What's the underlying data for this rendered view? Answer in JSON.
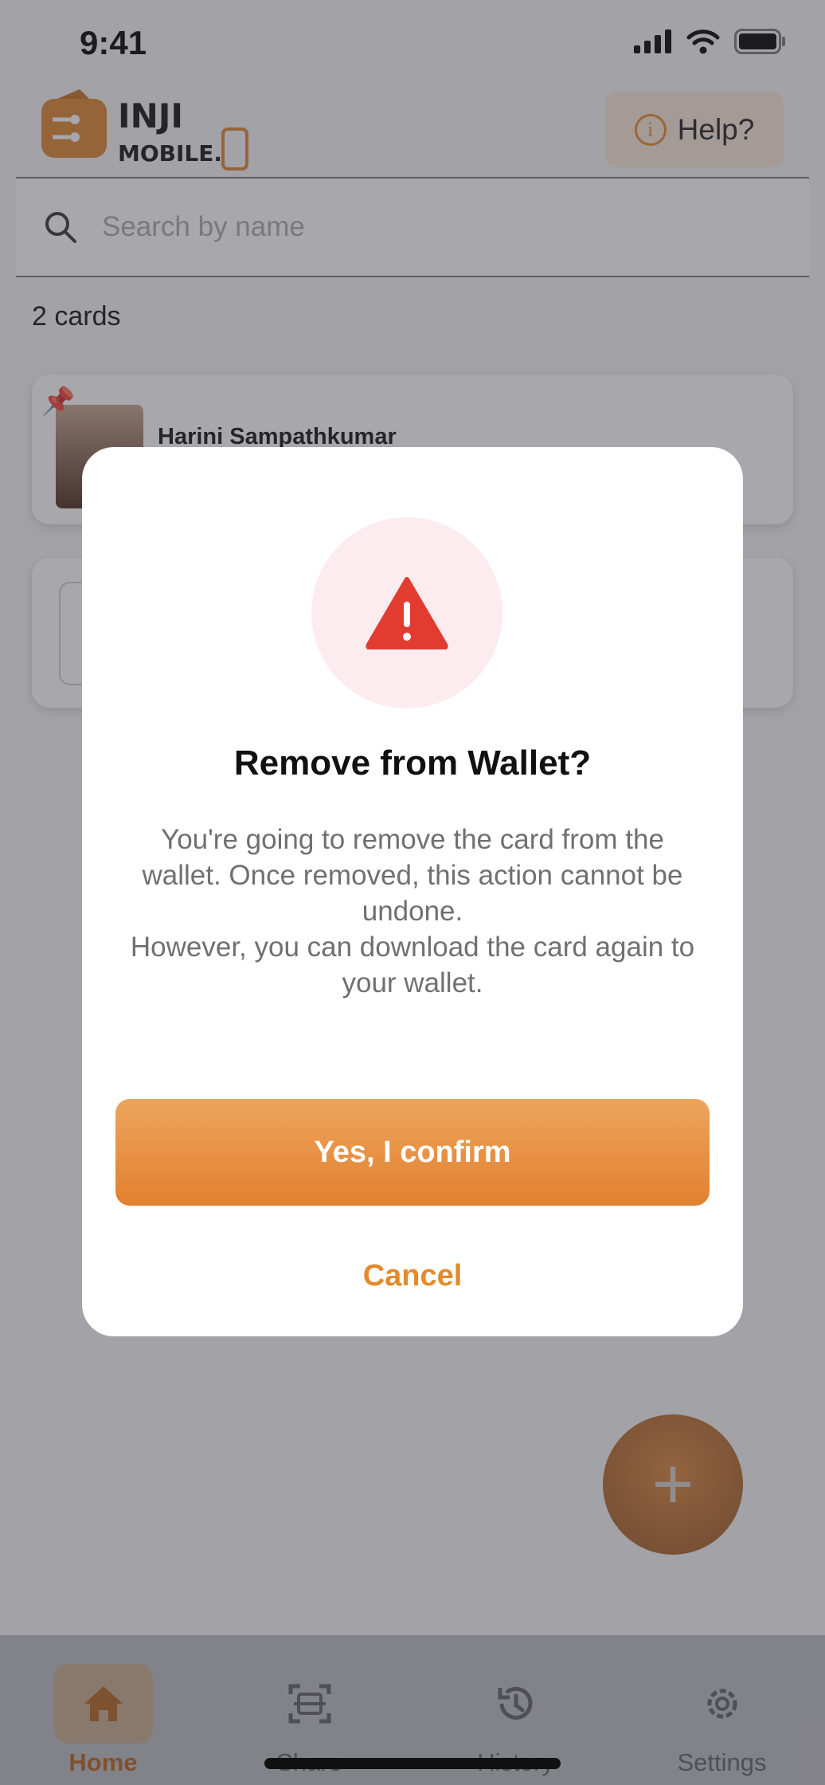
{
  "status_bar": {
    "time": "9:41"
  },
  "header": {
    "logo_text_1": "INJI",
    "logo_text_2": "MOBILE.",
    "help_label": "Help?"
  },
  "search": {
    "placeholder": "Search by name"
  },
  "cards": {
    "count_label": "2 cards",
    "items": [
      {
        "name": "Harini Sampathkumar",
        "pinned": true
      }
    ]
  },
  "fab": {
    "icon": "plus-icon"
  },
  "bottom_nav": {
    "items": [
      {
        "label": "Home",
        "icon": "home-icon",
        "active": true
      },
      {
        "label": "Share",
        "icon": "scan-icon",
        "active": false
      },
      {
        "label": "History",
        "icon": "history-icon",
        "active": false
      },
      {
        "label": "Settings",
        "icon": "gear-icon",
        "active": false
      }
    ]
  },
  "modal": {
    "title": "Remove from Wallet?",
    "body_line_1": "You're going to remove the card from the wallet. Once removed, this action cannot be undone.",
    "body_line_2": "However, you can download the card again to your wallet.",
    "confirm_label": "Yes, I confirm",
    "cancel_label": "Cancel"
  },
  "colors": {
    "accent": "#E58A2C",
    "warning": "#E23B30",
    "warning_bg": "#FDECEF"
  }
}
